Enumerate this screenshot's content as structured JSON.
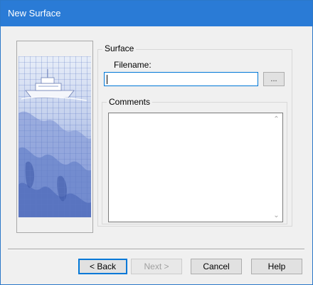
{
  "window": {
    "title": "New Surface",
    "accent_color": "#2a7bd6"
  },
  "surface_group": {
    "legend": "Surface",
    "filename_label": "Filename:",
    "filename_value": "",
    "browse_label": "..."
  },
  "comments_group": {
    "legend": "Comments",
    "value": ""
  },
  "buttons": {
    "back": "< Back",
    "next": "Next >",
    "cancel": "Cancel",
    "help": "Help"
  },
  "icons": {
    "picture": "boat-over-seafloor-grid-image",
    "scroll_up": "scroll-up-icon",
    "scroll_down": "scroll-down-icon"
  }
}
